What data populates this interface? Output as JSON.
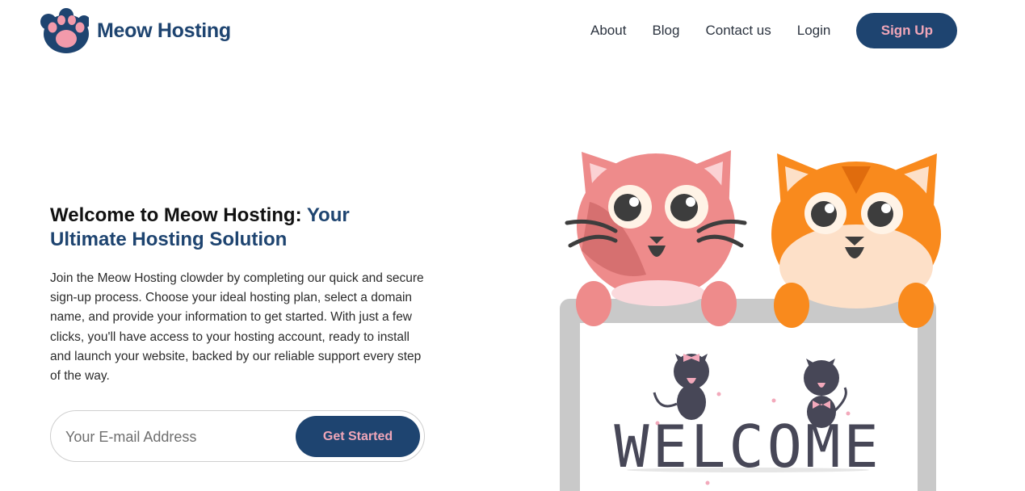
{
  "brand": {
    "name": "Meow Hosting",
    "logo_icon": "paw-icon",
    "primary_color": "#1e4470",
    "accent_color": "#f0a6b8"
  },
  "nav": {
    "links": [
      "About",
      "Blog",
      "Contact us",
      "Login"
    ],
    "signup_label": "Sign Up"
  },
  "hero": {
    "title_lead": "Welcome to Meow Hosting: ",
    "title_accent": "Your Ultimate Hosting Solution",
    "description": "Join the Meow Hosting clowder by completing our quick and secure sign-up process. Choose your ideal hosting plan, select a domain name, and provide your information to get started. With just a few clicks, you'll have access to your hosting account, ready to install and launch your website, backed by our reliable support every step of the way."
  },
  "signup_form": {
    "email_placeholder": "Your E-mail Address",
    "email_value": "",
    "submit_label": "Get Started"
  },
  "illustration": {
    "sign_text": "WELCOME",
    "icon": "welcome-cats-illustration"
  }
}
